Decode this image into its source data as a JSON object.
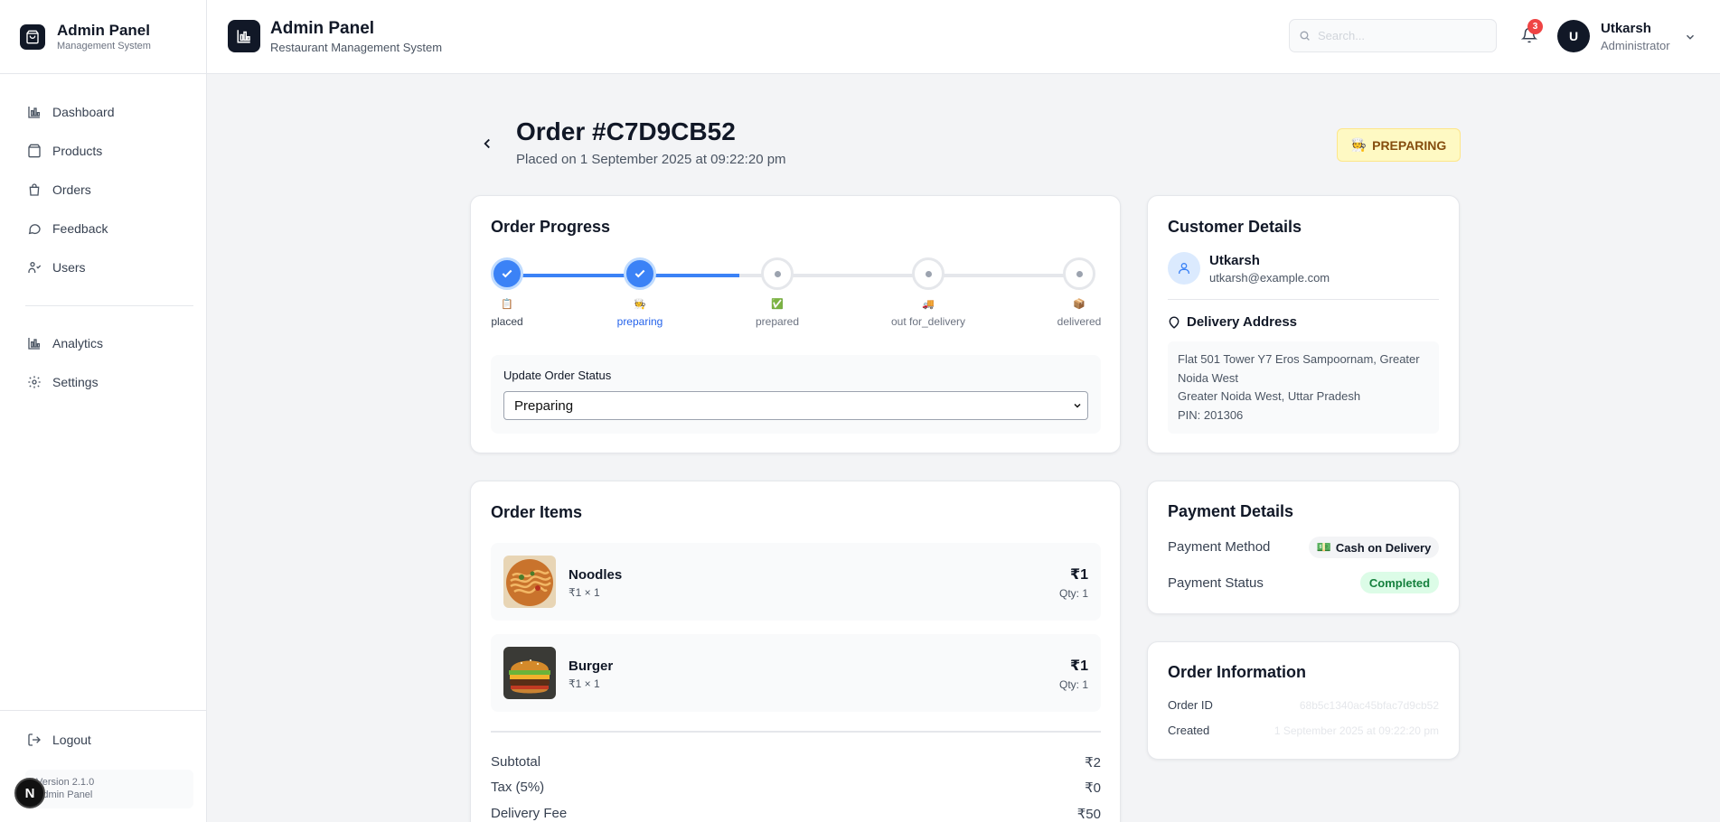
{
  "sidebar": {
    "brand_title": "Admin Panel",
    "brand_sub": "Management System",
    "items": [
      {
        "label": "Dashboard",
        "icon": "bar-chart-icon"
      },
      {
        "label": "Products",
        "icon": "package-icon"
      },
      {
        "label": "Orders",
        "icon": "shopping-bag-icon"
      },
      {
        "label": "Feedback",
        "icon": "message-icon"
      },
      {
        "label": "Users",
        "icon": "users-icon"
      }
    ],
    "items2": [
      {
        "label": "Analytics",
        "icon": "bar-chart-icon"
      },
      {
        "label": "Settings",
        "icon": "gear-icon"
      }
    ],
    "logout_label": "Logout",
    "version_line1": "Version 2.1.0",
    "version_line2": "Admin Panel",
    "n_badge": "N"
  },
  "header": {
    "title": "Admin Panel",
    "subtitle": "Restaurant Management System",
    "search_placeholder": "Search...",
    "notification_count": "3",
    "user_initial": "U",
    "user_name": "Utkarsh",
    "user_role": "Administrator"
  },
  "order": {
    "title": "Order #C7D9CB52",
    "placed_on": "Placed on 1 September 2025 at 09:22:20 pm",
    "status_emoji": "🧑‍🍳",
    "status_label": "PREPARING"
  },
  "progress": {
    "title": "Order Progress",
    "steps": [
      {
        "emoji": "📋",
        "label": "placed",
        "state": "done"
      },
      {
        "emoji": "🧑‍🍳",
        "label": "preparing",
        "state": "active"
      },
      {
        "emoji": "✅",
        "label": "prepared",
        "state": "todo"
      },
      {
        "emoji": "🚚",
        "label": "out for_delivery",
        "state": "todo"
      },
      {
        "emoji": "📦",
        "label": "delivered",
        "state": "todo"
      }
    ],
    "update_label": "Update Order Status",
    "selected_status": "Preparing"
  },
  "items": {
    "title": "Order Items",
    "list": [
      {
        "name": "Noodles",
        "sub": "₹1 × 1",
        "price": "₹1",
        "qty": "Qty: 1"
      },
      {
        "name": "Burger",
        "sub": "₹1 × 1",
        "price": "₹1",
        "qty": "Qty: 1"
      }
    ],
    "summary": [
      {
        "label": "Subtotal",
        "value": "₹2"
      },
      {
        "label": "Tax (5%)",
        "value": "₹0"
      },
      {
        "label": "Delivery Fee",
        "value": "₹50"
      }
    ]
  },
  "customer": {
    "title": "Customer Details",
    "name": "Utkarsh",
    "email": "utkarsh@example.com",
    "address_title": "Delivery Address",
    "address_line1": "Flat 501 Tower Y7 Eros Sampoornam, Greater Noida West",
    "address_line2": "Greater Noida West, Uttar Pradesh",
    "address_line3": "PIN: 201306"
  },
  "payment": {
    "title": "Payment Details",
    "method_label": "Payment Method",
    "method_value": "Cash on Delivery",
    "method_emoji": "💵",
    "status_label": "Payment Status",
    "status_value": "Completed"
  },
  "info": {
    "title": "Order Information",
    "id_label": "Order ID",
    "id_value": "68b5c1340ac45bfac7d9cb52",
    "created_label": "Created",
    "created_value": "1 September 2025 at 09:22:20 pm"
  },
  "colors": {
    "accent": "#3b82f6",
    "status_bg": "#fef9c3",
    "success": "#15803d"
  }
}
